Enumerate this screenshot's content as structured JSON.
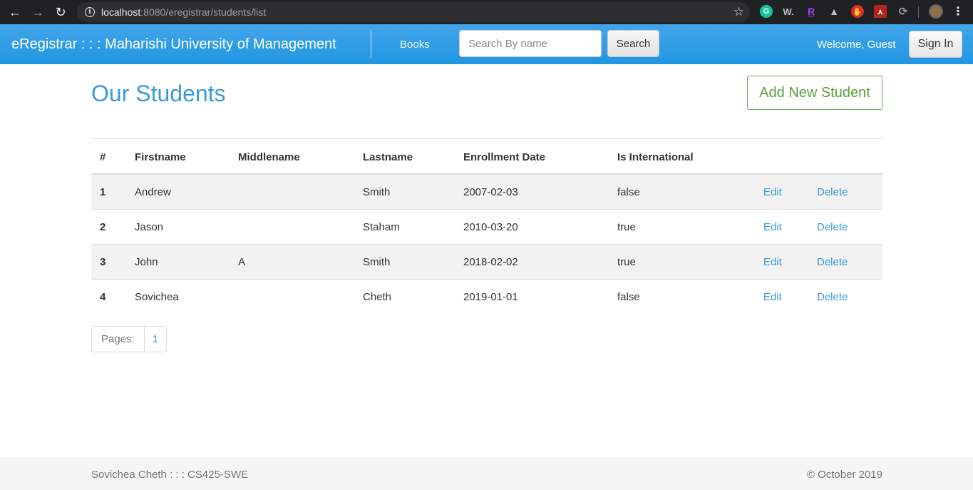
{
  "browser": {
    "url_host": "localhost",
    "url_path": ":8080/eregistrar/students/list"
  },
  "navbar": {
    "brand": "eRegistrar : : : Maharishi University of Management",
    "books_link": "Books",
    "search_placeholder": "Search By name",
    "search_button": "Search",
    "welcome": "Welcome, Guest",
    "signin_button": "Sign In"
  },
  "main": {
    "title": "Our Students",
    "add_button": "Add New Student"
  },
  "table": {
    "headers": [
      "#",
      "Firstname",
      "Middlename",
      "Lastname",
      "Enrollment Date",
      "Is International"
    ],
    "rows": [
      {
        "num": "1",
        "first": "Andrew",
        "middle": "",
        "last": "Smith",
        "date": "2007-02-03",
        "intl": "false",
        "edit": "Edit",
        "delete": "Delete"
      },
      {
        "num": "2",
        "first": "Jason",
        "middle": "",
        "last": "Staham",
        "date": "2010-03-20",
        "intl": "true",
        "edit": "Edit",
        "delete": "Delete"
      },
      {
        "num": "3",
        "first": "John",
        "middle": "A",
        "last": "Smith",
        "date": "2018-02-02",
        "intl": "true",
        "edit": "Edit",
        "delete": "Delete"
      },
      {
        "num": "4",
        "first": "Sovichea",
        "middle": "",
        "last": "Cheth",
        "date": "2019-01-01",
        "intl": "false",
        "edit": "Edit",
        "delete": "Delete"
      }
    ]
  },
  "pager": {
    "label": "Pages:",
    "pages": [
      "1"
    ]
  },
  "footer": {
    "left": "Sovichea Cheth : : : CS425-SWE",
    "right": "© October 2019"
  },
  "colors": {
    "navbar": "#2196e3",
    "title": "#3a9ad9",
    "add_button": "#5b9e3c"
  }
}
